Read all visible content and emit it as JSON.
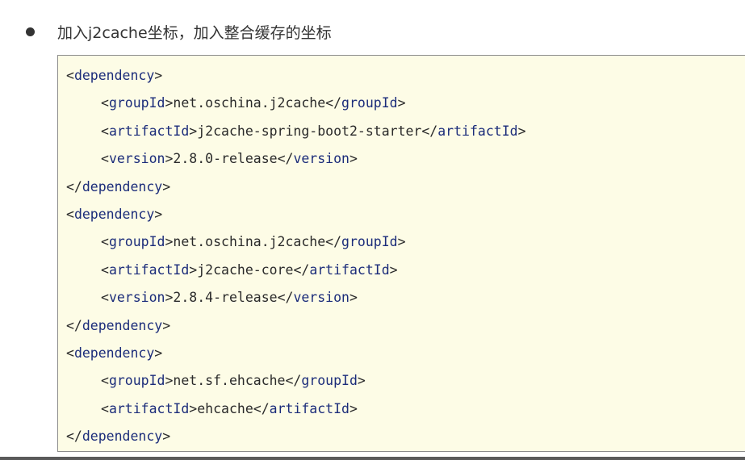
{
  "bullet": {
    "text": "加入j2cache坐标，加入整合缓存的坐标"
  },
  "code": {
    "lines": [
      {
        "indent": false,
        "tag": "dependency",
        "closing": false
      },
      {
        "indent": true,
        "tag": "groupId",
        "value": "net.oschina.j2cache"
      },
      {
        "indent": true,
        "tag": "artifactId",
        "value": "j2cache-spring-boot2-starter"
      },
      {
        "indent": true,
        "tag": "version",
        "value": "2.8.0-release"
      },
      {
        "indent": false,
        "tag": "dependency",
        "closing": true
      },
      {
        "indent": false,
        "tag": "dependency",
        "closing": false
      },
      {
        "indent": true,
        "tag": "groupId",
        "value": "net.oschina.j2cache"
      },
      {
        "indent": true,
        "tag": "artifactId",
        "value": "j2cache-core"
      },
      {
        "indent": true,
        "tag": "version",
        "value": "2.8.4-release"
      },
      {
        "indent": false,
        "tag": "dependency",
        "closing": true
      },
      {
        "indent": false,
        "tag": "dependency",
        "closing": false
      },
      {
        "indent": true,
        "tag": "groupId",
        "value": "net.sf.ehcache"
      },
      {
        "indent": true,
        "tag": "artifactId",
        "value": "ehcache"
      },
      {
        "indent": false,
        "tag": "dependency",
        "closing": true
      }
    ]
  },
  "colors": {
    "code_background": "#fdfce6",
    "tag_name": "#1b2c7a",
    "text": "#2a2a2a"
  }
}
